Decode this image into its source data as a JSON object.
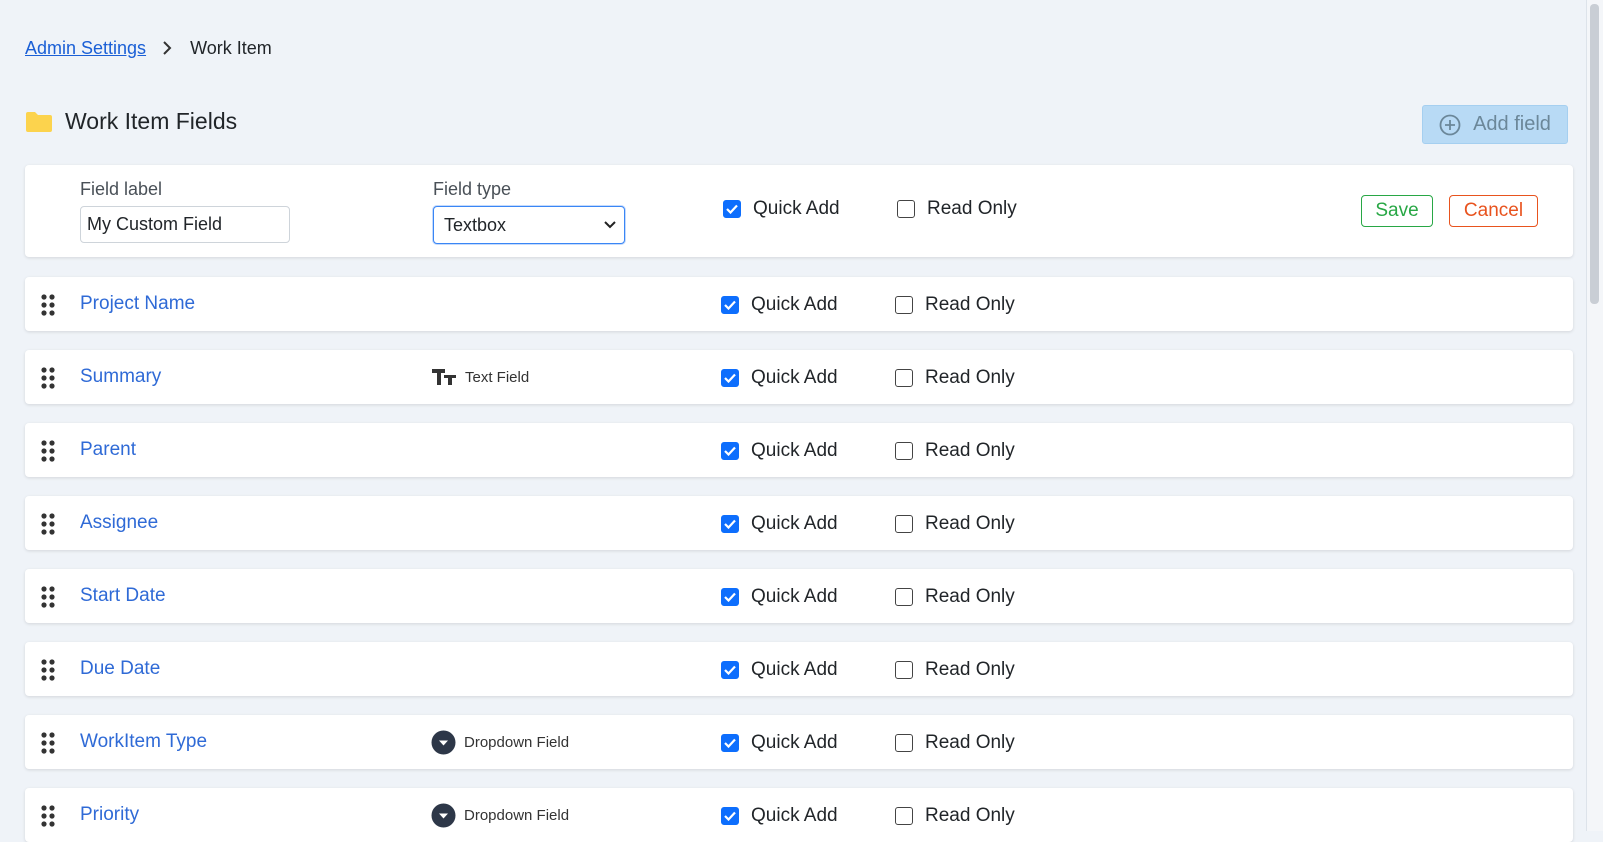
{
  "breadcrumb": {
    "parent": "Admin Settings",
    "current": "Work Item"
  },
  "page": {
    "title": "Work Item Fields",
    "add_button": "Add field"
  },
  "editor": {
    "label_caption": "Field label",
    "label_value": "My Custom Field",
    "type_caption": "Field type",
    "type_value": "Textbox",
    "quick_add_label": "Quick Add",
    "quick_add_checked": true,
    "read_only_label": "Read Only",
    "read_only_checked": false,
    "save_label": "Save",
    "cancel_label": "Cancel"
  },
  "fields": [
    {
      "name": "Project Name",
      "type": "",
      "type_icon": "",
      "quick_add": "Quick Add",
      "read_only": "Read Only"
    },
    {
      "name": "Summary",
      "type": "Text Field",
      "type_icon": "text-field-icon",
      "quick_add": "Quick Add",
      "read_only": "Read Only"
    },
    {
      "name": "Parent",
      "type": "",
      "type_icon": "",
      "quick_add": "Quick Add",
      "read_only": "Read Only"
    },
    {
      "name": "Assignee",
      "type": "",
      "type_icon": "",
      "quick_add": "Quick Add",
      "read_only": "Read Only"
    },
    {
      "name": "Start Date",
      "type": "",
      "type_icon": "",
      "quick_add": "Quick Add",
      "read_only": "Read Only"
    },
    {
      "name": "Due Date",
      "type": "",
      "type_icon": "",
      "quick_add": "Quick Add",
      "read_only": "Read Only"
    },
    {
      "name": "WorkItem Type",
      "type": "Dropdown Field",
      "type_icon": "dropdown-field-icon",
      "quick_add": "Quick Add",
      "read_only": "Read Only"
    },
    {
      "name": "Priority",
      "type": "Dropdown Field",
      "type_icon": "dropdown-field-icon",
      "quick_add": "Quick Add",
      "read_only": "Read Only"
    }
  ],
  "colors": {
    "background": "#eff3f8",
    "link": "#2f6ad6",
    "checkbox": "#0d6efd",
    "save": "#28a745",
    "cancel": "#e8531e",
    "folder": "#fcd34d",
    "add_button_bg": "#b8daf5"
  }
}
